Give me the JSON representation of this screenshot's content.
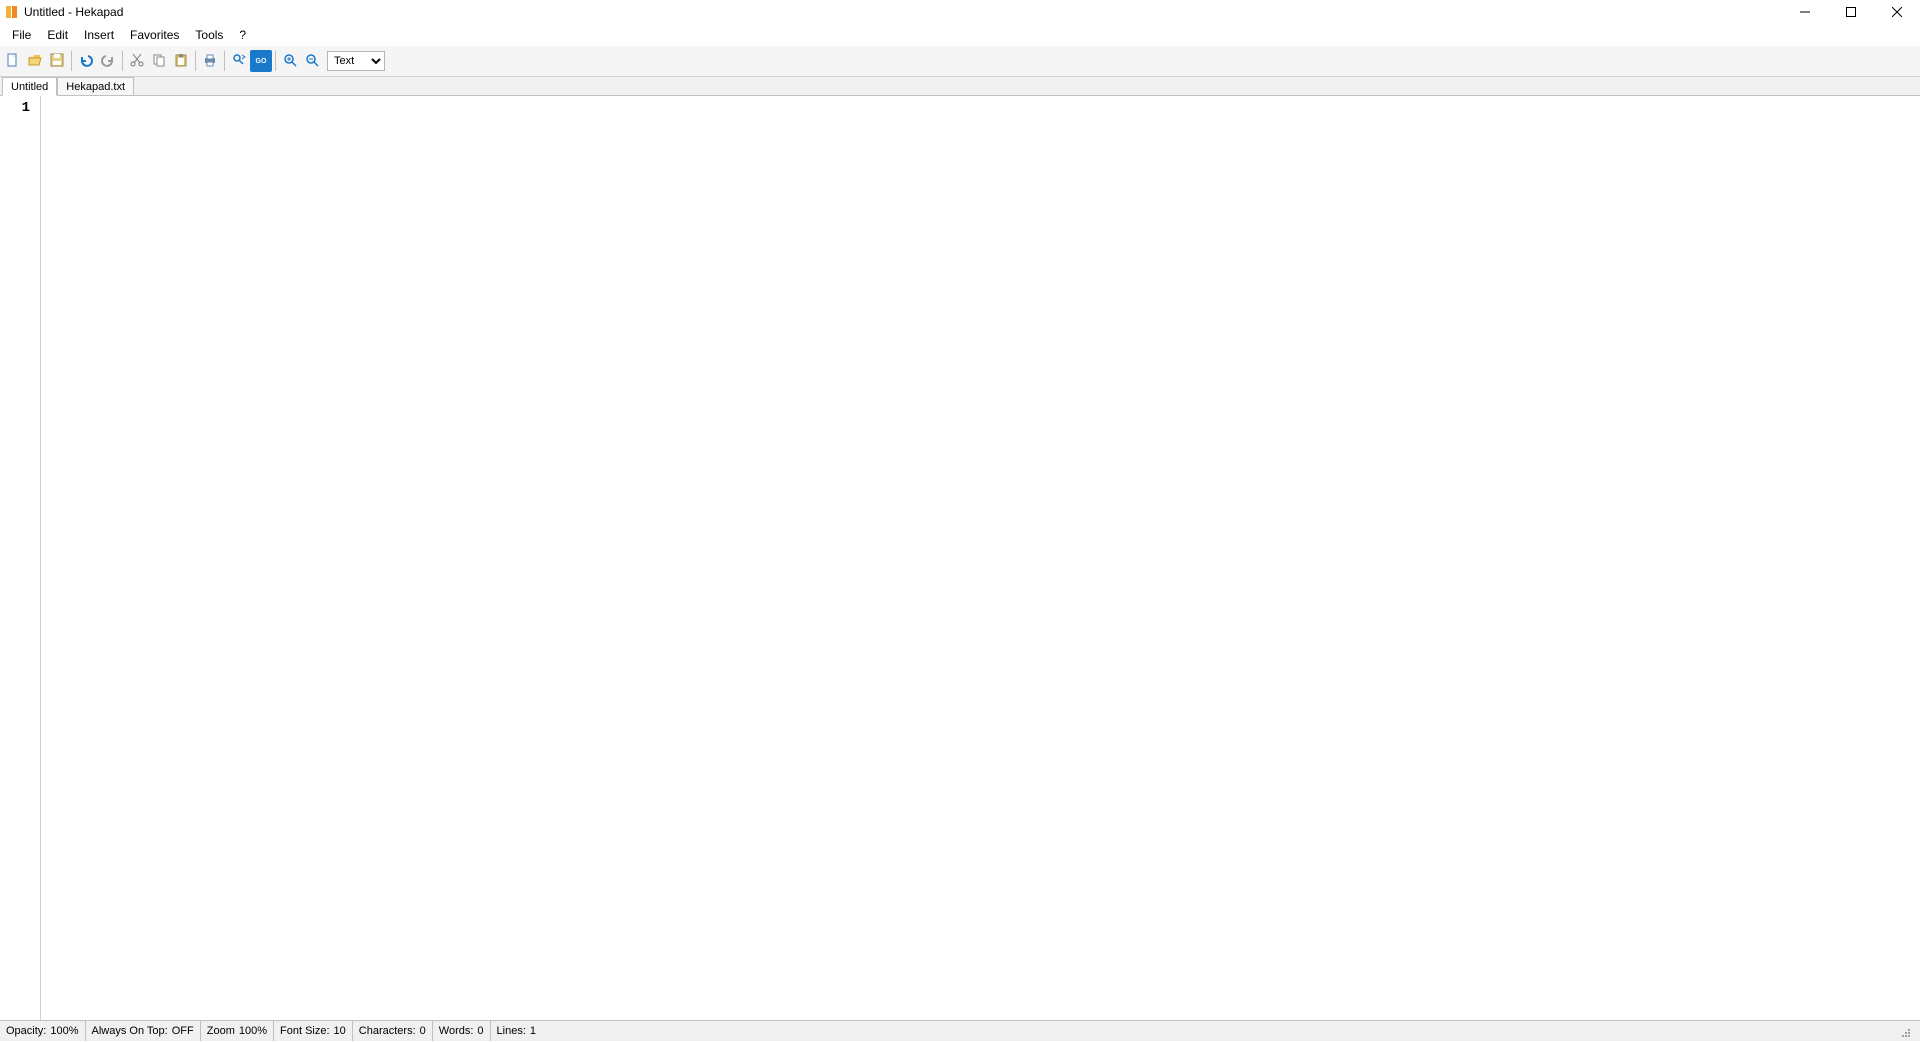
{
  "window": {
    "title": "Untitled - Hekapad"
  },
  "menu": {
    "file": "File",
    "edit": "Edit",
    "insert": "Insert",
    "favorites": "Favorites",
    "tools": "Tools",
    "help": "?"
  },
  "toolbar": {
    "syntax_value": "Text"
  },
  "tabs": [
    {
      "label": "Untitled",
      "active": true
    },
    {
      "label": "Hekapad.txt",
      "active": false
    }
  ],
  "editor": {
    "line_numbers": [
      "1"
    ],
    "content": ""
  },
  "status": {
    "opacity_label": "Opacity:",
    "opacity_value": "100%",
    "aot_label": "Always On Top:",
    "aot_value": "OFF",
    "zoom_label": "Zoom",
    "zoom_value": "100%",
    "font_label": "Font Size:",
    "font_value": "10",
    "chars_label": "Characters:",
    "chars_value": "0",
    "words_label": "Words:",
    "words_value": "0",
    "lines_label": "Lines:",
    "lines_value": "1"
  }
}
